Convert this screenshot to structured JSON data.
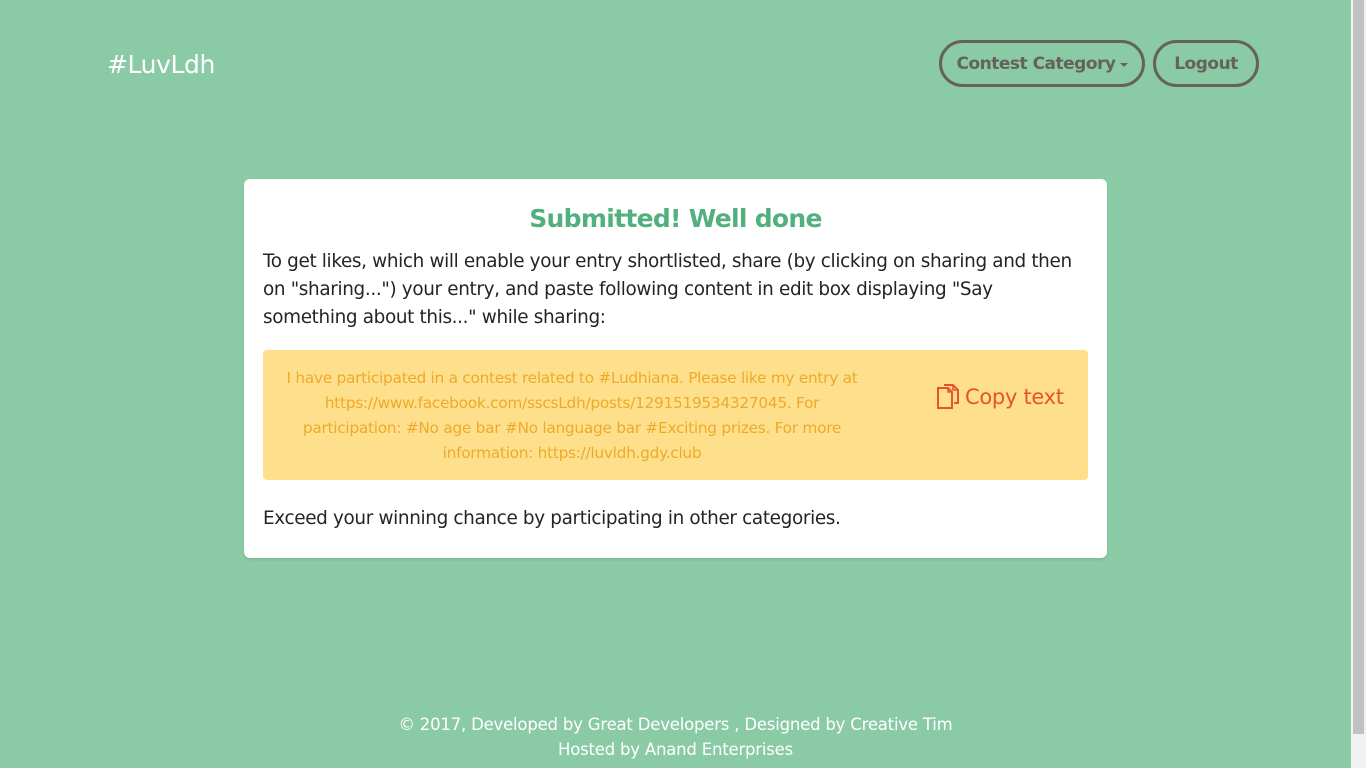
{
  "navbar": {
    "brand": "#LuvLdh",
    "category_label": "Contest Category",
    "logout_label": "Logout"
  },
  "card": {
    "title": "Submitted! Well done",
    "description": "To get likes, which will enable your entry shortlisted, share (by clicking on sharing and then on \"sharing...\") your entry, and paste following content in edit box displaying \"Say something about this...\" while sharing:",
    "share_text": "I have participated in a contest related to #Ludhiana. Please like my entry at https://www.facebook.com/sscsLdh/posts/1291519534327045. For participation: #No age bar #No language bar #Exciting prizes. For more information: https://luvldh.gdy.club",
    "copy_label": "Copy text",
    "footer_text": "Exceed your winning chance by participating in other categories."
  },
  "footer": {
    "line1_prefix": "© 2017, Developed by ",
    "developer_link": "Great Developers",
    "line1_middle": " , Designed by ",
    "designer_link": "Creative Tim",
    "line2": "Hosted by Anand Enterprises"
  },
  "colors": {
    "background": "#8acaa5",
    "title_green": "#51b07d",
    "warning_bg": "#fee08c",
    "warning_text": "#eeaa2a",
    "copy_orange": "#e8532d",
    "nav_button_border": "#66615b"
  },
  "icons": {
    "copy": "copy-icon",
    "dropdown": "caret-down-icon"
  }
}
